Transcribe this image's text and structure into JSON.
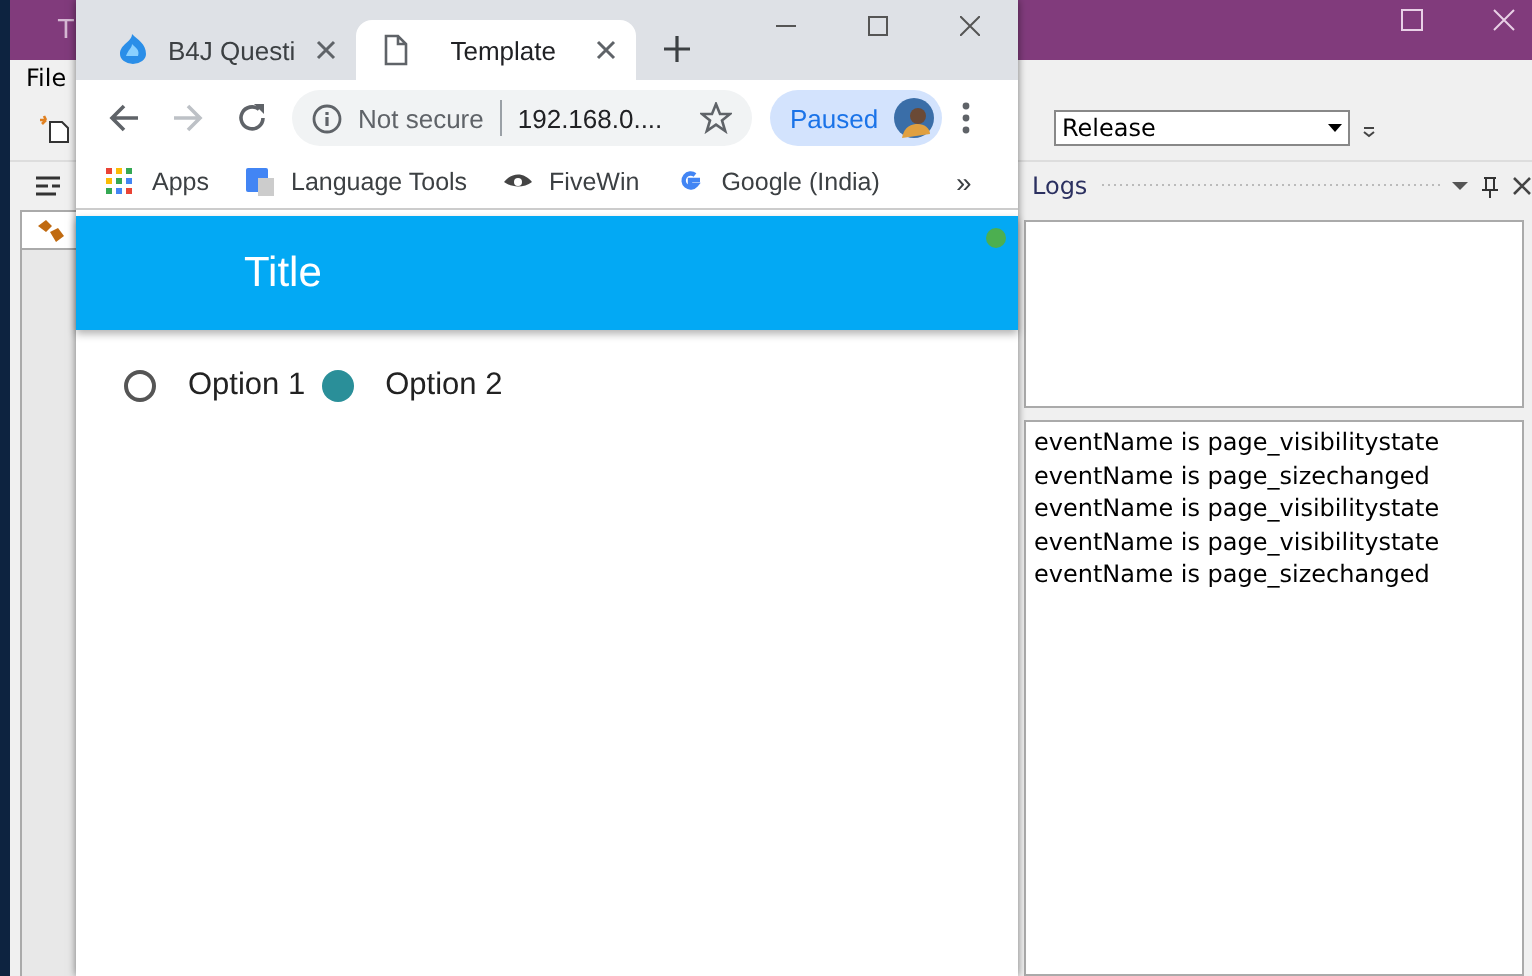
{
  "ide": {
    "title": "T",
    "menu": [
      "File"
    ],
    "config_combo": {
      "value": "Release"
    },
    "logs_panel": {
      "title": "Logs",
      "lines": [
        "eventName is page_visibilitystate",
        "eventName is page_sizechanged",
        "eventName is page_visibilitystate",
        "eventName is page_visibilitystate",
        "eventName is page_sizechanged"
      ]
    }
  },
  "browser": {
    "tabs": [
      {
        "title": "B4J Questi",
        "selected": false
      },
      {
        "title": "Template",
        "selected": true
      }
    ],
    "forward": {
      "disabled": true
    },
    "address": {
      "security": "Not secure",
      "url": "192.168.0...."
    },
    "profile": {
      "status": "Paused"
    },
    "bookmarks": [
      {
        "label": "Apps"
      },
      {
        "label": "Language Tools"
      },
      {
        "label": "FiveWin"
      },
      {
        "label": "Google (India)"
      }
    ],
    "overflow": "»",
    "page": {
      "header_title": "Title",
      "options": [
        {
          "label": "Option 1",
          "selected": false
        },
        {
          "label": "Option 2",
          "selected": true
        }
      ]
    }
  }
}
